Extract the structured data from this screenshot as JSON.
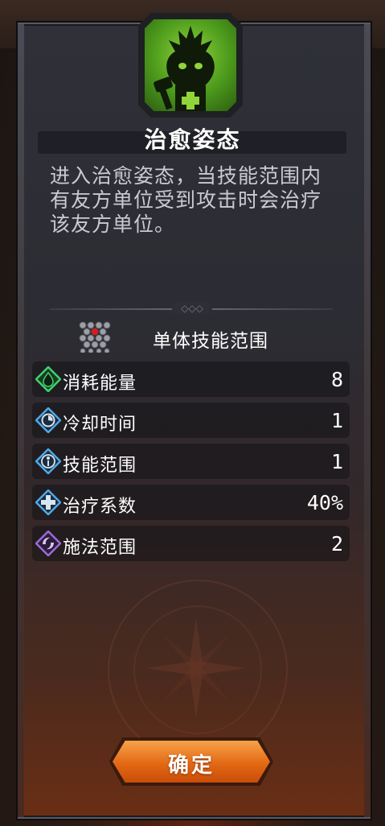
{
  "skill": {
    "name": "治愈姿态",
    "icon": "healing-stance-icon",
    "description": "进入治愈姿态，当技能范围内有友方单位受到攻击时会治疗该友方单位。"
  },
  "range": {
    "label": "单体技能范围",
    "icon": "range-grid-icon"
  },
  "stats": [
    {
      "label": "消耗能量",
      "value": "8",
      "icon": "energy-icon",
      "color": "#3fd36a"
    },
    {
      "label": "冷却时间",
      "value": "1",
      "icon": "cooldown-icon",
      "color": "#4ea9e8"
    },
    {
      "label": "技能范围",
      "value": "1",
      "icon": "skill-range-icon",
      "color": "#4ea9e8"
    },
    {
      "label": "治疗系数",
      "value": "40%",
      "icon": "heal-coefficient-icon",
      "color": "#4ea9e8"
    },
    {
      "label": "施法范围",
      "value": "2",
      "icon": "cast-range-icon",
      "color": "#9a6ad8"
    }
  ],
  "confirm_label": "确定"
}
